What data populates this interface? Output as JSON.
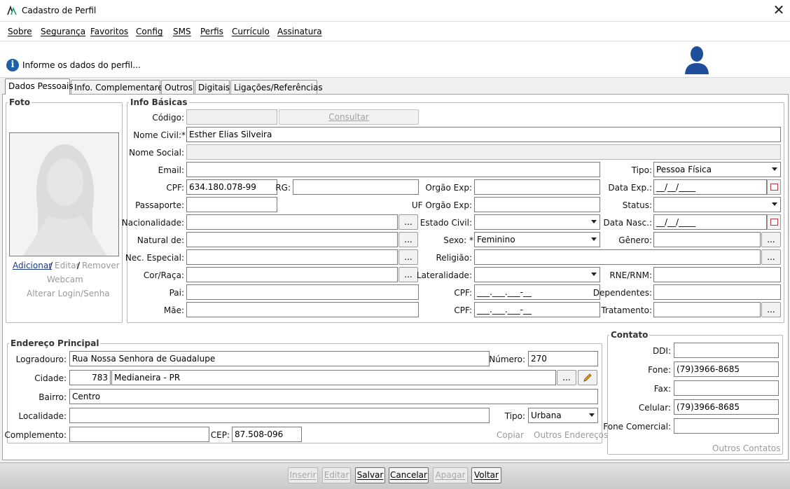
{
  "window": {
    "title": "Cadastro de Perfil",
    "close_glyph": "✕",
    "logo_icon": "app-logo-icon"
  },
  "menu": {
    "items": [
      "Sobre",
      "Segurança",
      "Favoritos",
      "Config",
      "SMS",
      "Perfis",
      "Currículo",
      "Assinatura"
    ]
  },
  "header": {
    "info_text": "Informe os dados do perfil...",
    "info_glyph": "i",
    "avatar_icon": "user-silhouette-icon"
  },
  "tabs": [
    "Dados Pessoais",
    "Info. Complementares",
    "Outros",
    "Digitais",
    "Ligações/Referências"
  ],
  "foto": {
    "legend": "Foto",
    "adicionar": "Adicionar",
    "sep1": "/",
    "editar": "Editar",
    "sep2": "/",
    "remover": "Remover",
    "webcam": "Webcam",
    "alterar_login": "Alterar Login/Senha"
  },
  "info": {
    "legend": "Info Básicas",
    "codigo_label": "Código:",
    "codigo_value": "",
    "consultar": "Consultar",
    "nome_civil_label": "Nome Civil:*",
    "nome_civil_value": "Esther Elias Silveira",
    "nome_social_label": "Nome Social:",
    "nome_social_value": "",
    "email_label": "Email:",
    "email_value": "",
    "tipo_label": "Tipo:",
    "tipo_value": "Pessoa Física",
    "cpf_label": "CPF:",
    "cpf_value": "634.180.078-99",
    "rg_label": "RG:",
    "rg_value": "",
    "orgao_exp_label": "Orgão Exp:",
    "orgao_exp_value": "",
    "data_exp_label": "Data Exp.:",
    "data_exp_value": "__/__/____",
    "passaporte_label": "Passaporte:",
    "passaporte_value": "",
    "uf_orgao_label": "UF Orgão Exp:",
    "uf_orgao_value": "",
    "status_label": "Status:",
    "status_value": "",
    "nacionalidade_label": "Nacionalidade:",
    "nacionalidade_value": "",
    "estado_civil_label": "Estado Civil:",
    "estado_civil_value": "",
    "data_nasc_label": "Data Nasc.:",
    "data_nasc_value": "__/__/____",
    "natural_label": "Natural de:",
    "natural_value": "",
    "sexo_label": "Sexo: *",
    "sexo_value": "Feminino",
    "genero_label": "Gênero:",
    "genero_value": "",
    "nec_label": "Nec. Especial:",
    "nec_value": "",
    "religiao_label": "Religião:",
    "religiao_value": "",
    "cor_label": "Cor/Raça:",
    "cor_value": "",
    "lateralidade_label": "Lateralidade:",
    "lateralidade_value": "",
    "rne_label": "RNE/RNM:",
    "rne_value": "",
    "pai_label": "Pai:",
    "pai_value": "",
    "cpf_pai_label": "CPF:",
    "cpf_pai_value": "___.___.___-__",
    "dependentes_label": "Dependentes:",
    "dependentes_value": "",
    "mae_label": "Mãe:",
    "mae_value": "",
    "cpf_mae_label": "CPF:",
    "cpf_mae_value": "___.___.___-__",
    "tratamento_label": "Tratamento:",
    "tratamento_value": "",
    "ellipsis": "..."
  },
  "endereco": {
    "legend": "Endereço Principal",
    "logradouro_label": "Logradouro:",
    "logradouro_value": "Rua Nossa Senhora de Guadalupe",
    "numero_label": "Número:",
    "numero_value": "270",
    "cidade_label": "Cidade:",
    "cidade_code": "783",
    "cidade_value": "Medianeira - PR",
    "bairro_label": "Bairro:",
    "bairro_value": "Centro",
    "localidade_label": "Localidade:",
    "localidade_value": "",
    "tipo_label": "Tipo:",
    "tipo_value": "Urbana",
    "complemento_label": "Complemento:",
    "complemento_value": "",
    "cep_label": "CEP:",
    "cep_value": "87.508-096",
    "copiar": "Copiar",
    "outros": "Outros Endereços"
  },
  "contato": {
    "legend": "Contato",
    "ddi_label": "DDI:",
    "ddi_value": "",
    "fone_label": "Fone:",
    "fone_value": "(79)3966-8685",
    "fax_label": "Fax:",
    "fax_value": "",
    "celular_label": "Celular:",
    "celular_value": "(79)3966-8685",
    "fone_com_label": "Fone Comercial:",
    "fone_com_value": "",
    "outros": "Outros Contatos"
  },
  "footer": {
    "inserir": "Inserir",
    "editar": "Editar",
    "salvar": "Salvar",
    "cancelar": "Cancelar",
    "apagar": "Apagar",
    "voltar": "Voltar"
  }
}
